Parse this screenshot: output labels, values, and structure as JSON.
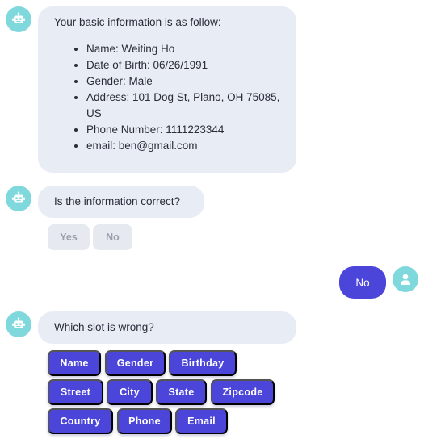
{
  "colors": {
    "bot_bubble": "#e8ecf5",
    "user_bubble": "#4b45d9",
    "avatar": "#7fd8dc",
    "slot_button": "#4b45d9",
    "disabled_button": "#e6e9f0"
  },
  "messages": [
    {
      "sender": "bot",
      "icon": "robot-icon",
      "intro": "Your basic information is as follow:",
      "items": [
        "Name: Weiting Ho",
        "Date of Birth: 06/26/1991",
        "Gender: Male",
        "Address: 101 Dog St, Plano, OH 75085, US",
        "Phone Number: 1111223344",
        "email: ben@gmail.com"
      ]
    },
    {
      "sender": "bot",
      "icon": "robot-icon",
      "text": "Is the information correct?",
      "quick_replies": [
        "Yes",
        "No"
      ]
    },
    {
      "sender": "user",
      "icon": "user-icon",
      "text": "No"
    },
    {
      "sender": "bot",
      "icon": "robot-icon",
      "text": "Which slot is wrong?",
      "slot_buttons": [
        "Name",
        "Gender",
        "Birthday",
        "Street",
        "City",
        "State",
        "Zipcode",
        "Country",
        "Phone",
        "Email"
      ]
    }
  ]
}
